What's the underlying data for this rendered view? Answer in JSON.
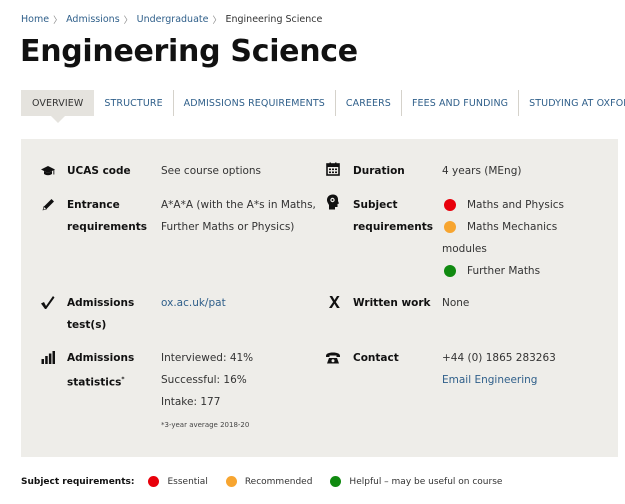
{
  "breadcrumb": {
    "items": [
      "Home",
      "Admissions",
      "Undergraduate"
    ],
    "separator": "〉",
    "current": "Engineering Science"
  },
  "page": {
    "title": "Engineering Science"
  },
  "tabs": [
    {
      "label": "OVERVIEW",
      "active": true
    },
    {
      "label": "STRUCTURE",
      "active": false
    },
    {
      "label": "ADMISSIONS REQUIREMENTS",
      "active": false
    },
    {
      "label": "CAREERS",
      "active": false
    },
    {
      "label": "FEES AND FUNDING",
      "active": false
    },
    {
      "label": "STUDYING AT OXFORD",
      "active": false
    }
  ],
  "facts": {
    "ucas": {
      "label": "UCAS code",
      "value": "See course options",
      "icon": "mortarboard-icon"
    },
    "duration": {
      "label": "Duration",
      "value": "4 years (MEng)",
      "icon": "calendar-icon"
    },
    "entrance": {
      "label_line1": "Entrance",
      "label_line2": "requirements",
      "value_line1": "A*A*A (with the A*s in Maths,",
      "value_line2": "Further Maths or Physics)",
      "icon": "pencil-icon"
    },
    "subject": {
      "label_line1": "Subject",
      "label_line2": "requirements",
      "icon": "head-icon",
      "items": [
        {
          "level": "essential",
          "text": "Maths and Physics"
        },
        {
          "level": "recommended",
          "text": "Maths Mechanics",
          "continuation": "modules"
        },
        {
          "level": "helpful",
          "text": "Further Maths"
        }
      ]
    },
    "test": {
      "label_line1": "Admissions",
      "label_line2": "test(s)",
      "value": "ox.ac.uk/pat",
      "icon": "checkmark-icon"
    },
    "written": {
      "label": "Written work",
      "value": "None",
      "icon": "cross-icon"
    },
    "stats": {
      "label_line1": "Admissions",
      "label_line2": "statistics",
      "label_sup": "*",
      "icon": "bar-chart-icon",
      "interviewed": "Interviewed: 41%",
      "successful": "Successful: 16%",
      "intake": "Intake: 177",
      "footnote": "*3-year average 2018-20"
    },
    "contact": {
      "label": "Contact",
      "phone": "+44 (0) 1865 283263",
      "email": "Email Engineering",
      "icon": "telephone-icon"
    }
  },
  "legend": {
    "title": "Subject requirements:",
    "essential": "Essential",
    "recommended": "Recommended",
    "helpful": "Helpful – may be useful on course"
  },
  "colors": {
    "essential": "#e8000b",
    "recommended": "#f7a530",
    "helpful": "#108a10",
    "link": "#2f5f8a",
    "panel": "#eeede9"
  }
}
